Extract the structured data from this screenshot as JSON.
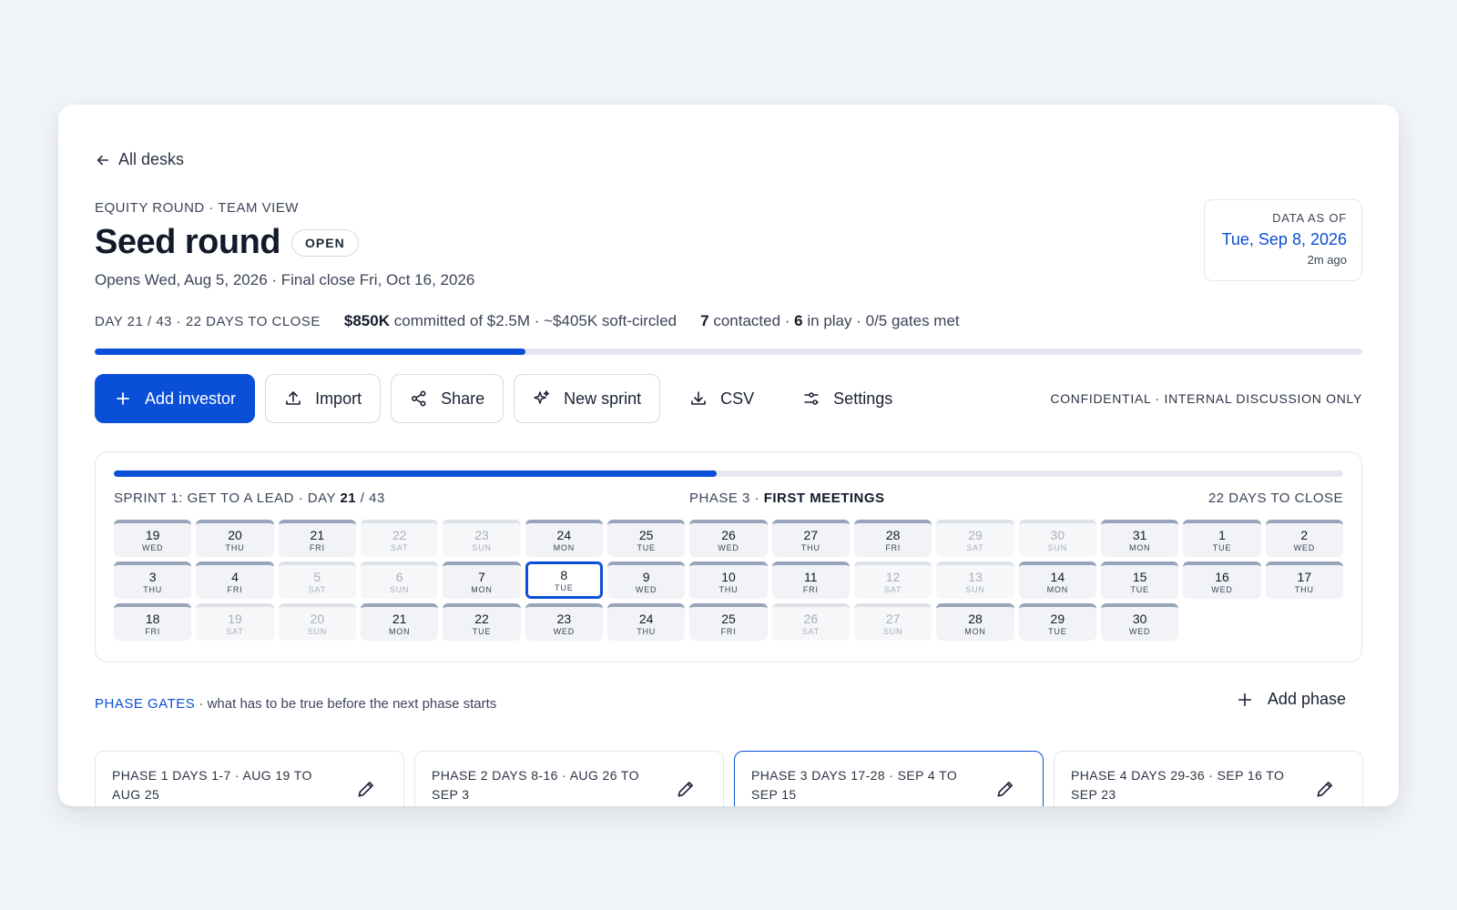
{
  "nav": {
    "back_label": "All desks"
  },
  "header": {
    "eyebrow": "EQUITY ROUND · TEAM VIEW",
    "title": "Seed round",
    "status_badge": "OPEN",
    "dates": "Opens Wed, Aug 5, 2026 · Final close Fri, Oct 16, 2026"
  },
  "as_of": {
    "label": "DATA AS OF",
    "date": "Tue, Sep 8, 2026",
    "relative": "2m ago"
  },
  "stats": {
    "day_progress": "DAY 21 / 43 · 22 DAYS TO CLOSE",
    "committed_amount": "$850K",
    "committed_rest": "committed of $2.5M · ~$405K soft-circled",
    "contacted_count": "7",
    "contacted_label": "contacted ·",
    "in_play_count": "6",
    "in_play_rest": "in play · 0/5 gates met",
    "raise_progress": 0.34
  },
  "toolbar": {
    "add_investor": "Add investor",
    "import": "Import",
    "share": "Share",
    "new_sprint": "New sprint",
    "csv": "CSV",
    "settings": "Settings",
    "confidential": "CONFIDENTIAL · INTERNAL DISCUSSION ONLY"
  },
  "sprint": {
    "label_prefix": "SPRINT 1: GET TO A LEAD · DAY",
    "day": "21",
    "day_total": "/ 43",
    "phase_prefix": "PHASE 3 ·",
    "phase_name": "FIRST MEETINGS",
    "to_close": "22 DAYS TO CLOSE",
    "progress": 0.49,
    "days": [
      {
        "n": "19",
        "w": "WED",
        "weekend": false
      },
      {
        "n": "20",
        "w": "THU",
        "weekend": false
      },
      {
        "n": "21",
        "w": "FRI",
        "weekend": false
      },
      {
        "n": "22",
        "w": "SAT",
        "weekend": true
      },
      {
        "n": "23",
        "w": "SUN",
        "weekend": true
      },
      {
        "n": "24",
        "w": "MON",
        "weekend": false
      },
      {
        "n": "25",
        "w": "TUE",
        "weekend": false
      },
      {
        "n": "26",
        "w": "WED",
        "weekend": false
      },
      {
        "n": "27",
        "w": "THU",
        "weekend": false
      },
      {
        "n": "28",
        "w": "FRI",
        "weekend": false
      },
      {
        "n": "29",
        "w": "SAT",
        "weekend": true
      },
      {
        "n": "30",
        "w": "SUN",
        "weekend": true
      },
      {
        "n": "31",
        "w": "MON",
        "weekend": false
      },
      {
        "n": "1",
        "w": "TUE",
        "weekend": false
      },
      {
        "n": "2",
        "w": "WED",
        "weekend": false
      },
      {
        "n": "3",
        "w": "THU",
        "weekend": false
      },
      {
        "n": "4",
        "w": "FRI",
        "weekend": false
      },
      {
        "n": "5",
        "w": "SAT",
        "weekend": true
      },
      {
        "n": "6",
        "w": "SUN",
        "weekend": true
      },
      {
        "n": "7",
        "w": "MON",
        "weekend": false
      },
      {
        "n": "8",
        "w": "TUE",
        "weekend": false,
        "today": true
      },
      {
        "n": "9",
        "w": "WED",
        "weekend": false
      },
      {
        "n": "10",
        "w": "THU",
        "weekend": false
      },
      {
        "n": "11",
        "w": "FRI",
        "weekend": false
      },
      {
        "n": "12",
        "w": "SAT",
        "weekend": true
      },
      {
        "n": "13",
        "w": "SUN",
        "weekend": true
      },
      {
        "n": "14",
        "w": "MON",
        "weekend": false
      },
      {
        "n": "15",
        "w": "TUE",
        "weekend": false
      },
      {
        "n": "16",
        "w": "WED",
        "weekend": false
      },
      {
        "n": "17",
        "w": "THU",
        "weekend": false
      },
      {
        "n": "18",
        "w": "FRI",
        "weekend": false
      },
      {
        "n": "19",
        "w": "SAT",
        "weekend": true
      },
      {
        "n": "20",
        "w": "SUN",
        "weekend": true
      },
      {
        "n": "21",
        "w": "MON",
        "weekend": false
      },
      {
        "n": "22",
        "w": "TUE",
        "weekend": false
      },
      {
        "n": "23",
        "w": "WED",
        "weekend": false
      },
      {
        "n": "24",
        "w": "THU",
        "weekend": false
      },
      {
        "n": "25",
        "w": "FRI",
        "weekend": false
      },
      {
        "n": "26",
        "w": "SAT",
        "weekend": true
      },
      {
        "n": "27",
        "w": "SUN",
        "weekend": true
      },
      {
        "n": "28",
        "w": "MON",
        "weekend": false
      },
      {
        "n": "29",
        "w": "TUE",
        "weekend": false
      },
      {
        "n": "30",
        "w": "WED",
        "weekend": false
      }
    ]
  },
  "gates": {
    "title": "PHASE GATES",
    "subtitle": "· what has to be true before the next phase starts",
    "add_phase": "Add phase",
    "phases": [
      {
        "label": "PHASE 1 DAYS 1-7 · AUG 19 TO AUG 25",
        "active": false
      },
      {
        "label": "PHASE 2 DAYS 8-16 · AUG 26 TO SEP 3",
        "active": false
      },
      {
        "label": "PHASE 3 DAYS 17-28 · SEP 4 TO SEP 15",
        "active": true
      },
      {
        "label": "PHASE 4 DAYS 29-36 · SEP 16 TO SEP 23",
        "active": false
      }
    ]
  },
  "colors": {
    "accent": "#0a4fd8",
    "track": "#e4e7ed",
    "page_bg": "#f1f4f8"
  }
}
